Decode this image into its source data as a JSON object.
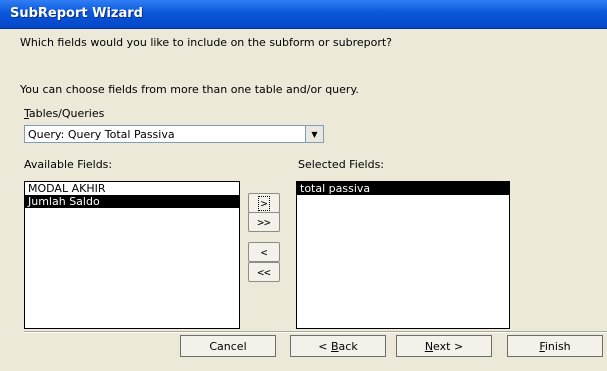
{
  "window": {
    "title": "SubReport Wizard"
  },
  "prompt": "Which fields would you like to include on the subform or subreport?",
  "hint": "You can choose fields from more than one table and/or query.",
  "tables_queries": {
    "label_hotkey": "T",
    "label_rest": "ables/Queries",
    "selected": "Query: Query Total Passiva"
  },
  "available": {
    "label": "Available Fields:",
    "items": [
      "MODAL AKHIR",
      "Jumlah Saldo"
    ],
    "selected_index": 1
  },
  "selected_fields": {
    "label": "Selected Fields:",
    "items": [
      "total passiva"
    ],
    "selected_index": 0
  },
  "transfer": {
    "add_one": ">",
    "add_all": ">>",
    "remove_one": "<",
    "remove_all": "<<"
  },
  "buttons": {
    "cancel": "Cancel",
    "back_pre": "< ",
    "back_hotkey": "B",
    "back_rest": "ack",
    "next_hotkey": "N",
    "next_rest": "ext >",
    "finish_hotkey": "F",
    "finish_rest": "inish"
  }
}
